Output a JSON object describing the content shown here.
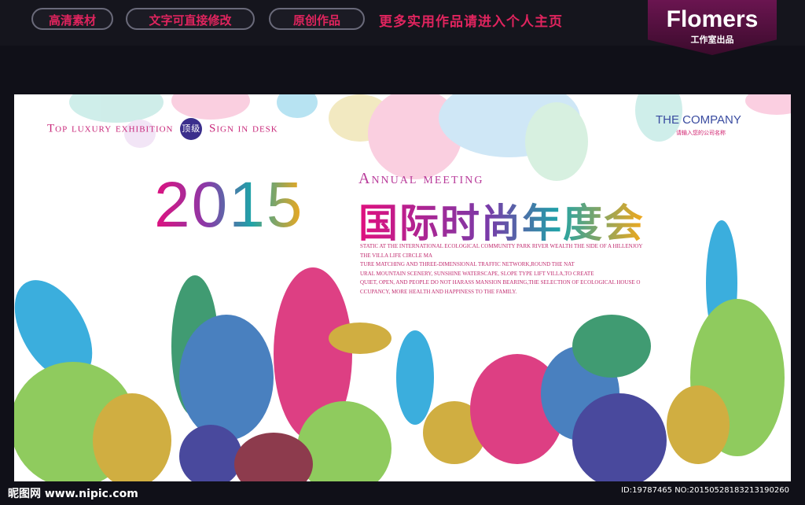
{
  "topbar": {
    "btn1": "高清素材",
    "btn2": "文字可直接修改",
    "btn3": "原创作品",
    "promo": "更多实用作品请进入个人主页",
    "brand": "Flomers",
    "brand_sub": "工作室出品"
  },
  "banner": {
    "top_left_1": "Top luxury exhibition",
    "top_left_badge": "顶级",
    "top_left_2": "Sign in desk",
    "company": "THE COMPANY",
    "company_sub": "请输入您的公司名称",
    "year": "2015",
    "annual": "Annual meeting",
    "title_cn": "国际时尚年度会",
    "paragraph": [
      "STATIC AT THE INTERNATIONAL ECOLOGICAL COMMUNITY PARK RIVER WEALTH THE SIDE OF A HILLENJOY",
      "THE VILLA LIFE CIRCLE MA",
      "TURE MATCHING AND THREE-DIMENSIONAL TRAFFIC NETWORK,ROUND THE NAT",
      "URAL MOUNTAIN SCENERY, SUNSHINE WATERSCAPE, SLOPE TYPE LIFT VILLA,TO CREATE",
      "QUIET, OPEN, AND PEOPLE DO NOT HARASS MANSION BEARING,THE SELECTION OF ECOLOGICAL HOUSE O",
      "CCUPANCY, MORE HEALTH AND HAPPINESS TO THE FAMILY."
    ]
  },
  "footer": {
    "logo": "昵图网 www.nipic.com",
    "id": "ID:19787465 NO:20150528183213190260"
  },
  "colors": {
    "accent": "#e0245e",
    "banner_bg": "#ffffff",
    "page_bg": "#101018"
  }
}
